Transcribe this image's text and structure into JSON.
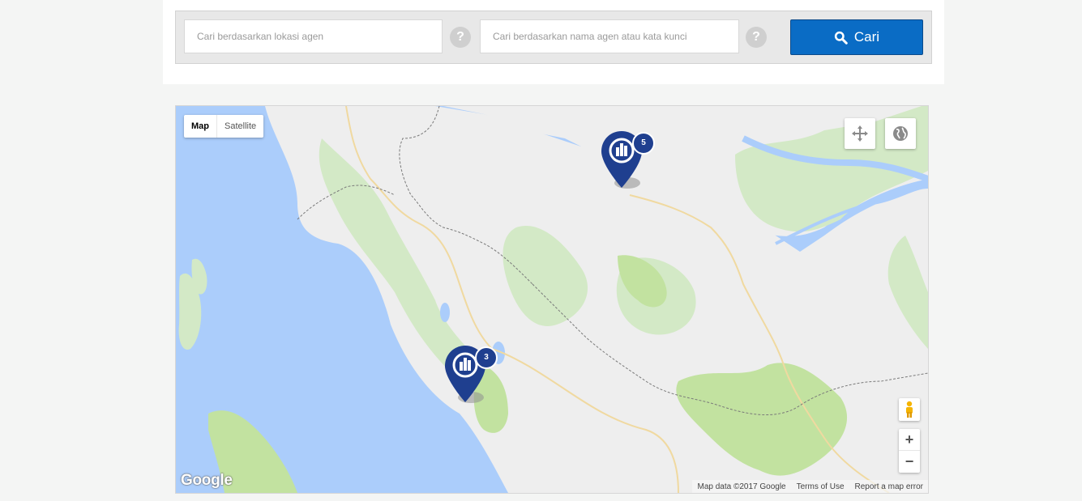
{
  "search": {
    "location_placeholder": "Cari berdasarkan lokasi agen",
    "location_value": "",
    "name_placeholder": "Cari berdasarkan nama agen atau kata kunci",
    "name_value": "",
    "help_glyph": "?",
    "button_label": "Cari",
    "button_icon": "search-icon"
  },
  "map": {
    "type_options": [
      "Map",
      "Satellite"
    ],
    "selected_type": "Map",
    "controls": {
      "pan_icon": "move-icon",
      "globe_icon": "globe-icon",
      "pegman_icon": "pegman-icon",
      "zoom_in": "+",
      "zoom_out": "−"
    },
    "markers": [
      {
        "id": "north",
        "count": "5",
        "icon": "agent-building-icon"
      },
      {
        "id": "south",
        "count": "3",
        "icon": "agent-building-icon"
      }
    ],
    "logo": "Google",
    "attribution": {
      "data": "Map data ©2017 Google",
      "terms": "Terms of Use",
      "report": "Report a map error"
    }
  },
  "colors": {
    "accent": "#0a6cc5",
    "marker": "#1f3f8f",
    "water": "#abcdfb",
    "land": "#eeeeee",
    "forest": "#d3e9c6",
    "park": "#c2e2a0"
  }
}
